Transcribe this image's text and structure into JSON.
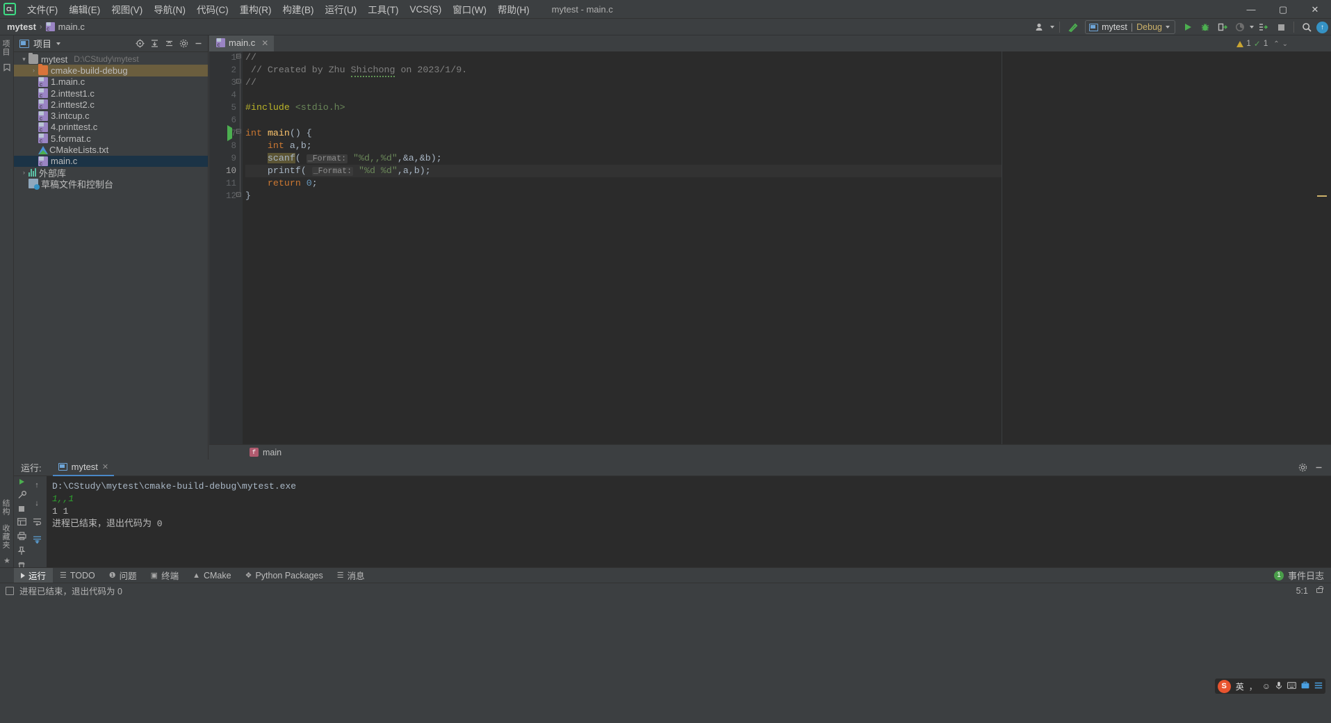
{
  "window": {
    "title": "mytest - main.c",
    "logo": "clion-logo",
    "controls": [
      {
        "name": "minimize",
        "glyph": "—"
      },
      {
        "name": "maximize",
        "glyph": "▢"
      },
      {
        "name": "close",
        "glyph": "✕"
      }
    ]
  },
  "menubar": {
    "items": [
      {
        "label": "文件(F)"
      },
      {
        "label": "编辑(E)"
      },
      {
        "label": "视图(V)"
      },
      {
        "label": "导航(N)"
      },
      {
        "label": "代码(C)"
      },
      {
        "label": "重构(R)"
      },
      {
        "label": "构建(B)"
      },
      {
        "label": "运行(U)"
      },
      {
        "label": "工具(T)"
      },
      {
        "label": "VCS(S)"
      },
      {
        "label": "窗口(W)"
      },
      {
        "label": "帮助(H)"
      }
    ]
  },
  "breadcrumb": {
    "root": "mytest",
    "separator": "›",
    "file": "main.c"
  },
  "toolbar": {
    "run_config": {
      "project": "mytest",
      "separator": "|",
      "mode": "Debug"
    },
    "buttons": [
      {
        "name": "run-button",
        "glyph": "▶"
      },
      {
        "name": "debug-button",
        "glyph": "🐞"
      },
      {
        "name": "attach-profiler-button",
        "glyph": "▣"
      },
      {
        "name": "coverage-button",
        "glyph": "◔"
      },
      {
        "name": "run-with-button",
        "glyph": "⇥"
      },
      {
        "name": "stop-button",
        "glyph": "■"
      },
      {
        "name": "search-everywhere-button",
        "glyph": "🔍"
      },
      {
        "name": "update-button",
        "glyph": "↑"
      }
    ]
  },
  "project_panel": {
    "title": "项目",
    "actions": [
      {
        "name": "select-opened-file-icon",
        "glyph": "⊕"
      },
      {
        "name": "expand-all-icon",
        "glyph": "⤒"
      },
      {
        "name": "collapse-all-icon",
        "glyph": "⤓"
      },
      {
        "name": "settings-gear-icon",
        "glyph": "⚙"
      },
      {
        "name": "hide-panel-icon",
        "glyph": "—"
      }
    ],
    "tree": [
      {
        "label": "mytest",
        "path": "D:\\CStudy\\mytest",
        "icon": "folder",
        "arrow": "▾",
        "indent": 0,
        "state": "normal"
      },
      {
        "label": "cmake-build-debug",
        "path": "",
        "icon": "folder-orange",
        "arrow": "›",
        "indent": 1,
        "state": "selected-dir"
      },
      {
        "label": "1.main.c",
        "path": "",
        "icon": "c-file",
        "arrow": "",
        "indent": 1,
        "state": "normal"
      },
      {
        "label": "2.inttest1.c",
        "path": "",
        "icon": "c-file",
        "arrow": "",
        "indent": 1,
        "state": "normal"
      },
      {
        "label": "2.inttest2.c",
        "path": "",
        "icon": "c-file",
        "arrow": "",
        "indent": 1,
        "state": "normal"
      },
      {
        "label": "3.intcup.c",
        "path": "",
        "icon": "c-file",
        "arrow": "",
        "indent": 1,
        "state": "normal"
      },
      {
        "label": "4.printtest.c",
        "path": "",
        "icon": "c-file",
        "arrow": "",
        "indent": 1,
        "state": "normal"
      },
      {
        "label": "5.format.c",
        "path": "",
        "icon": "c-file",
        "arrow": "",
        "indent": 1,
        "state": "normal"
      },
      {
        "label": "CMakeLists.txt",
        "path": "",
        "icon": "cmake",
        "arrow": "",
        "indent": 1,
        "state": "normal"
      },
      {
        "label": "main.c",
        "path": "",
        "icon": "c-file",
        "arrow": "",
        "indent": 1,
        "state": "selected-focus"
      },
      {
        "label": "外部库",
        "path": "",
        "icon": "library",
        "arrow": "›",
        "indent": 0,
        "state": "normal"
      },
      {
        "label": "草稿文件和控制台",
        "path": "",
        "icon": "scratch",
        "arrow": "",
        "indent": 0,
        "state": "normal"
      }
    ]
  },
  "editor": {
    "tab": {
      "label": "main.c",
      "close": "✕",
      "icon": "c-file-icon"
    },
    "inspection": {
      "warning_count": "1",
      "ok_count": "1",
      "warn_glyph": "⚠",
      "ok_glyph": "✓",
      "up_glyph": "⌃",
      "down_glyph": "⌄"
    },
    "cursor_position": "5:1",
    "lines": [
      {
        "n": "1",
        "fold": "⊟"
      },
      {
        "n": "2",
        "fold": ""
      },
      {
        "n": "3",
        "fold": "⊡"
      },
      {
        "n": "4",
        "fold": ""
      },
      {
        "n": "5",
        "fold": ""
      },
      {
        "n": "6",
        "fold": ""
      },
      {
        "n": "7",
        "fold": "⊟",
        "runmark": "▶"
      },
      {
        "n": "8",
        "fold": ""
      },
      {
        "n": "9",
        "fold": ""
      },
      {
        "n": "10",
        "fold": "",
        "current": true
      },
      {
        "n": "11",
        "fold": ""
      },
      {
        "n": "12",
        "fold": "⊡"
      }
    ],
    "code": {
      "l1": "//",
      "l2_prefix": "// Created by Zhu ",
      "l2_name": "Shichong",
      "l2_suffix": " on 2023/1/9.",
      "l3": "//",
      "l4": "",
      "l5_macro": "#include",
      "l5_header": "<stdio.h>",
      "l6": "",
      "l7_kw": "int",
      "l7_fn": "main",
      "l7_rest": "() {",
      "l8_kw": "int",
      "l8_rest": " a,b;",
      "l9_fn": "scanf",
      "l9_open": "(",
      "l9_hint": "_Format:",
      "l9_str": "\"%d,,%d\"",
      "l9_args": ",&a,&b);",
      "l10_fn": "printf",
      "l10_open": "(",
      "l10_hint": "_Format:",
      "l10_str": "\"%d %d\"",
      "l10_args": ",a,b);",
      "l11_kw": "return",
      "l11_num": "0",
      "l11_end": ";",
      "l12": "}"
    },
    "status_function": "main",
    "status_function_badge": "f"
  },
  "run_panel": {
    "label": "运行:",
    "tab": {
      "label": "mytest",
      "close": "✕"
    },
    "actions": [
      {
        "name": "settings-gear-icon",
        "glyph": "⚙"
      },
      {
        "name": "hide-panel-icon",
        "glyph": "—"
      }
    ],
    "side_buttons": [
      {
        "name": "rerun-button",
        "glyph": "▶"
      },
      {
        "name": "edit-configuration-button",
        "glyph": "🔧"
      },
      {
        "name": "stop-button",
        "glyph": "■"
      },
      {
        "name": "layout-button",
        "glyph": "▦"
      },
      {
        "name": "print-button",
        "glyph": "🖨"
      },
      {
        "name": "pin-button",
        "glyph": "📌"
      },
      {
        "name": "delete-button",
        "glyph": "🗑"
      }
    ],
    "side_buttons2": [
      {
        "name": "scroll-up-button",
        "glyph": "↑"
      },
      {
        "name": "scroll-down-button",
        "glyph": "↓"
      },
      {
        "name": "soft-wrap-button",
        "glyph": "⇥"
      },
      {
        "name": "scroll-to-end-button",
        "glyph": "⇊"
      }
    ],
    "console": [
      {
        "text": "D:\\CStudy\\mytest\\cmake-build-debug\\mytest.exe",
        "style": "path"
      },
      {
        "text": "1,,1",
        "style": "input"
      },
      {
        "text": "1 1",
        "style": "out"
      },
      {
        "text": "进程已结束，退出代码为 0",
        "style": "end"
      }
    ]
  },
  "tool_window_bar": {
    "items": [
      {
        "label": "运行",
        "icon": "▶",
        "active": true
      },
      {
        "label": "TODO",
        "icon": "☰",
        "active": false
      },
      {
        "label": "问题",
        "icon": "❶",
        "active": false
      },
      {
        "label": "终端",
        "icon": "▣",
        "active": false
      },
      {
        "label": "CMake",
        "icon": "▲",
        "active": false
      },
      {
        "label": "Python Packages",
        "icon": "❖",
        "active": false
      },
      {
        "label": "消息",
        "icon": "☰",
        "active": false
      }
    ],
    "event_log": {
      "label": "事件日志",
      "badge": "1"
    }
  },
  "statusbar": {
    "message": "进程已结束，退出代码为 0",
    "caret": "5:1",
    "lock": "lock-icon"
  },
  "left_rail": {
    "top_buttons": [
      {
        "name": "project-rail-label",
        "label": "项目"
      },
      {
        "name": "bookmarks-rail-icon",
        "glyph": "▤"
      }
    ],
    "bottom_buttons": [
      {
        "name": "structure-rail-label",
        "label": "结构"
      },
      {
        "name": "favorites-rail-label",
        "label": "收藏夹"
      },
      {
        "name": "star-rail-icon",
        "glyph": "★"
      }
    ]
  },
  "ime": {
    "brand": "S",
    "mode": "英",
    "icons": [
      {
        "name": "comma-icon",
        "glyph": "，"
      },
      {
        "name": "emoji-icon",
        "glyph": "☺"
      },
      {
        "name": "mic-icon",
        "glyph": "🎤"
      },
      {
        "name": "keyboard-icon",
        "glyph": "⌨"
      },
      {
        "name": "toolbox-icon",
        "glyph": "▣"
      },
      {
        "name": "menu-icon",
        "glyph": "☰"
      }
    ]
  },
  "colors": {
    "accent_blue": "#4a88c7",
    "selection_blue": "#1b3346",
    "selection_dir": "#6b5e3e",
    "bg_chrome": "#3c3f41",
    "bg_editor": "#2b2b2b",
    "green": "#4caf50",
    "orange_keyword": "#cc7832",
    "string_green": "#6a8759"
  }
}
